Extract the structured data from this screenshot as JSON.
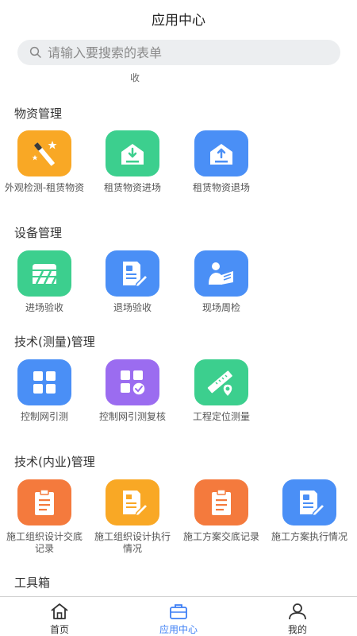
{
  "header": {
    "title": "应用中心"
  },
  "search": {
    "placeholder": "请输入要搜索的表单"
  },
  "cut_label": "收",
  "sections": [
    {
      "title": "物资管理",
      "items": [
        {
          "label": "外观检测-租赁物资",
          "color": "#f9a825",
          "icon": "magic-wand-icon"
        },
        {
          "label": "租赁物资进场",
          "color": "#3ccf8e",
          "icon": "inbox-download-icon"
        },
        {
          "label": "租赁物资退场",
          "color": "#4a8ff6",
          "icon": "inbox-upload-icon"
        }
      ]
    },
    {
      "title": "设备管理",
      "items": [
        {
          "label": "进场验收",
          "color": "#3ccf8e",
          "icon": "barrier-icon"
        },
        {
          "label": "退场验收",
          "color": "#4a8ff6",
          "icon": "document-edit-icon"
        },
        {
          "label": "现场周检",
          "color": "#4a8ff6",
          "icon": "person-reading-icon"
        }
      ]
    },
    {
      "title": "技术(测量)管理",
      "items": [
        {
          "label": "控制网引测",
          "color": "#4a8ff6",
          "icon": "grid-icon"
        },
        {
          "label": "控制网引测复核",
          "color": "#9b6cf0",
          "icon": "grid-check-icon"
        },
        {
          "label": "工程定位测量",
          "color": "#3ccf8e",
          "icon": "ruler-pin-icon"
        }
      ]
    },
    {
      "title": "技术(内业)管理",
      "items": [
        {
          "label": "施工组织设计交底记录",
          "color": "#f47a3d",
          "icon": "clipboard-icon"
        },
        {
          "label": "施工组织设计执行情况",
          "color": "#f9a825",
          "icon": "document-pen-icon"
        },
        {
          "label": "施工方案交底记录",
          "color": "#f47a3d",
          "icon": "clipboard-icon"
        },
        {
          "label": "施工方案执行情况",
          "color": "#4a8ff6",
          "icon": "document-edit-icon"
        }
      ]
    },
    {
      "title": "工具箱",
      "items": []
    }
  ],
  "tabbar": {
    "items": [
      {
        "label": "首页",
        "icon": "home-icon",
        "active": false
      },
      {
        "label": "应用中心",
        "icon": "briefcase-icon",
        "active": true
      },
      {
        "label": "我的",
        "icon": "user-icon",
        "active": false
      }
    ],
    "active_color": "#3d7ff5",
    "inactive_color": "#333333"
  }
}
